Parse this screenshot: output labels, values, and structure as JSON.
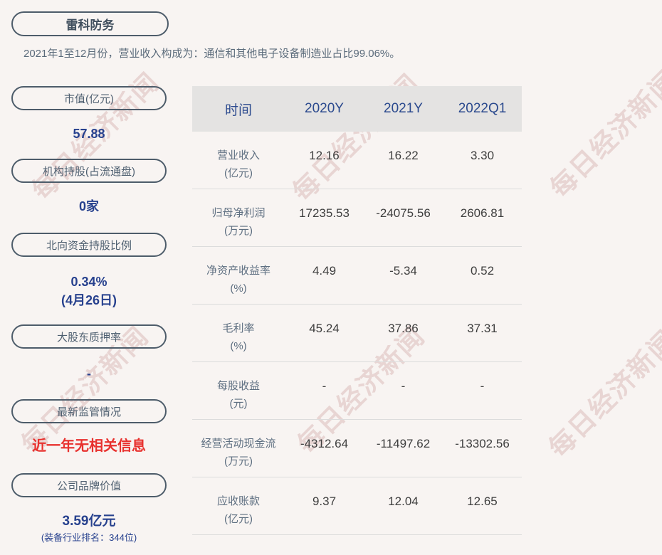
{
  "company": {
    "name": "雷科防务"
  },
  "subtitle": "2021年1至12月份，营业收入构成为：通信和其他电子设备制造业占比99.06%。",
  "watermark": {
    "text": "每日经济新闻"
  },
  "sidebar": {
    "items": [
      {
        "label": "市值(亿元)",
        "value": "57.88"
      },
      {
        "label": "机构持股(占流通盘)",
        "value": "0家"
      },
      {
        "label": "北向资金持股比例",
        "value": "0.34%",
        "value2": "(4月26日)"
      },
      {
        "label": "大股东质押率",
        "value": "-"
      },
      {
        "label": "最新监管情况",
        "value": "近一年无相关信息"
      },
      {
        "label": "公司品牌价值",
        "value": "3.59亿元",
        "value2": "(装备行业排名：344位)"
      }
    ]
  },
  "chart_data": {
    "type": "table",
    "columns": [
      "时间",
      "2020Y",
      "2021Y",
      "2022Q1"
    ],
    "rows": [
      {
        "metric": "营业收入",
        "unit": "(亿元)",
        "values": [
          "12.16",
          "16.22",
          "3.30"
        ]
      },
      {
        "metric": "归母净利润",
        "unit": "(万元)",
        "values": [
          "17235.53",
          "-24075.56",
          "2606.81"
        ]
      },
      {
        "metric": "净资产收益率",
        "unit": "(%)",
        "values": [
          "4.49",
          "-5.34",
          "0.52"
        ]
      },
      {
        "metric": "毛利率",
        "unit": "(%)",
        "values": [
          "45.24",
          "37.86",
          "37.31"
        ]
      },
      {
        "metric": "每股收益",
        "unit": "(元)",
        "values": [
          "-",
          "-",
          "-"
        ]
      },
      {
        "metric": "经营活动现金流",
        "unit": "(万元)",
        "values": [
          "-4312.64",
          "-11497.62",
          "-13302.56"
        ]
      },
      {
        "metric": "应收账款",
        "unit": "(亿元)",
        "values": [
          "9.37",
          "12.04",
          "12.65"
        ]
      }
    ]
  },
  "colors": {
    "background": "#f8f4f2",
    "accent_blue": "#27418e",
    "header_blue": "#2b4a8e",
    "alert_red": "#e8312e",
    "pill_border": "#4d5c6a",
    "table_header_bg": "#e4e3e2",
    "watermark_pink": "rgba(186,124,124,0.26)"
  }
}
